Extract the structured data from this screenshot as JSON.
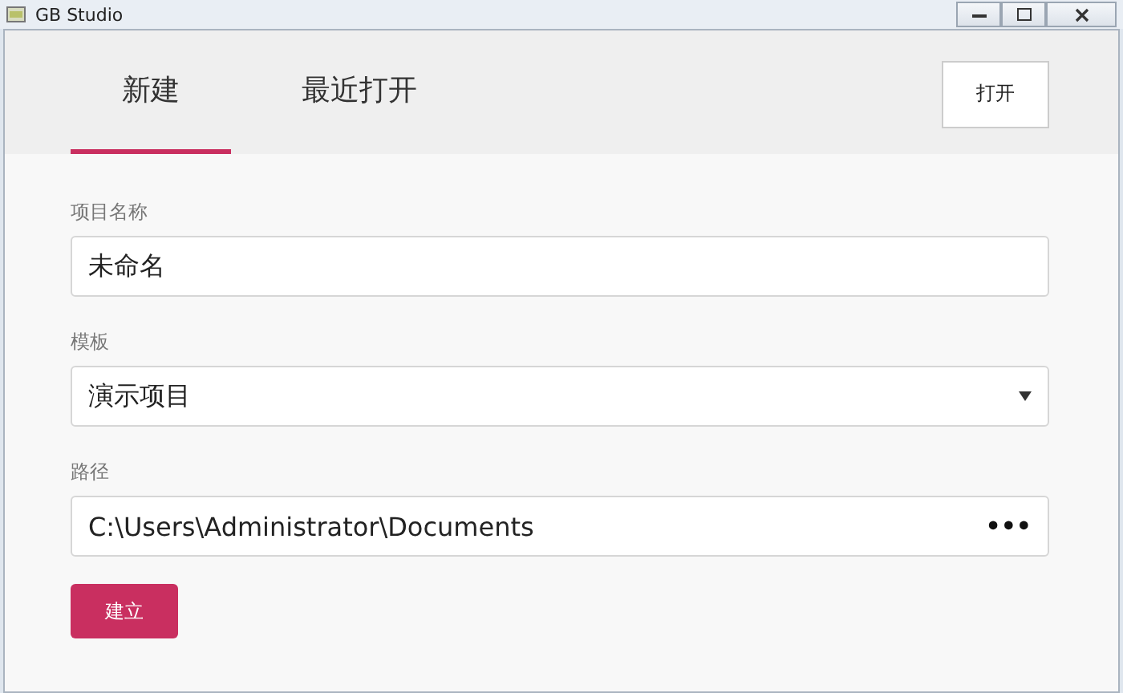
{
  "window": {
    "title": "GB Studio"
  },
  "tabs": [
    {
      "label": "新建",
      "selected": true
    },
    {
      "label": "最近打开",
      "selected": false
    }
  ],
  "open_button": "打开",
  "fields": [
    {
      "kind": "text",
      "label": "项目名称",
      "value": "未命名"
    },
    {
      "kind": "select",
      "label": "模板",
      "value": "演示项目"
    },
    {
      "kind": "path",
      "label": "路径",
      "value": "C:\\Users\\Administrator\\Documents",
      "button": "•••"
    }
  ],
  "create_button": "建立"
}
